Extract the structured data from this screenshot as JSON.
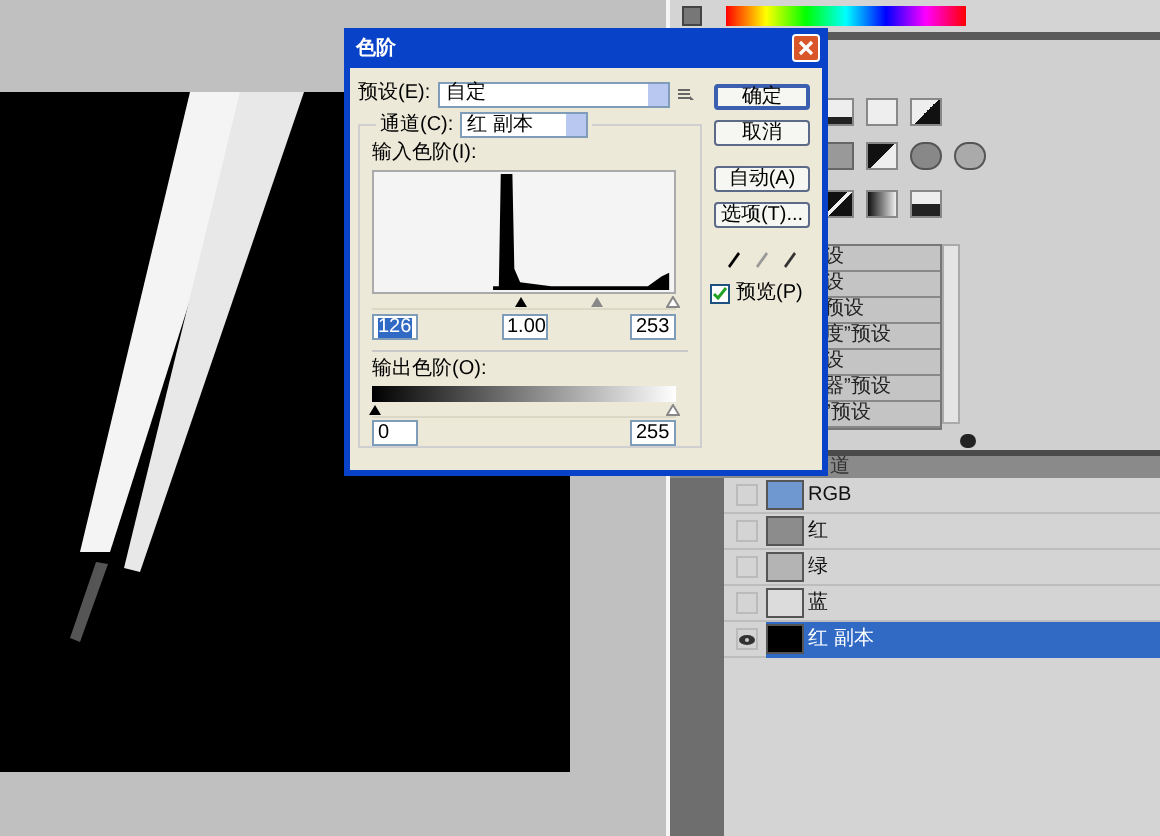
{
  "panels": {
    "presets": [
      "设",
      "设",
      "预设",
      "度”预设",
      "设",
      "器”预设",
      "”预设"
    ],
    "channels_tab": "道",
    "channels": [
      {
        "name": "RGB",
        "visible": false,
        "selected": false,
        "color": "#6f97d0"
      },
      {
        "name": "红",
        "visible": false,
        "selected": false,
        "color": "#8c8c8c"
      },
      {
        "name": "绿",
        "visible": false,
        "selected": false,
        "color": "#b4b4b4"
      },
      {
        "name": "蓝",
        "visible": false,
        "selected": false,
        "color": "#dcdcdc"
      },
      {
        "name": "红 副本",
        "visible": true,
        "selected": true,
        "color": "#000000"
      }
    ]
  },
  "dialog": {
    "title": "色阶",
    "preset_label": "预设(E):",
    "preset_value": "自定",
    "channel_label": "通道(C):",
    "channel_value": "红 副本",
    "input_label": "输入色阶(I):",
    "input_values": [
      {
        "value": "126",
        "selected": true
      },
      {
        "value": "1.00",
        "selected": false
      },
      {
        "value": "253",
        "selected": false
      }
    ],
    "input_thumbs": [
      {
        "kind": "black",
        "level": 0.49
      },
      {
        "kind": "gray",
        "level": 0.74
      },
      {
        "kind": "white",
        "level": 0.99
      }
    ],
    "output_label": "输出色阶(O):",
    "output_values": [
      "0",
      "255"
    ],
    "output_thumbs": [
      {
        "kind": "black",
        "level": 0.01
      },
      {
        "kind": "white",
        "level": 0.99
      }
    ],
    "buttons": [
      {
        "label": "确定",
        "default": true
      },
      {
        "label": "取消",
        "default": false
      },
      {
        "label": "自动(A)",
        "default": false
      },
      {
        "label": "选项(T)...",
        "default": false
      }
    ],
    "preview": {
      "label": "预览(P)",
      "checked": true
    }
  }
}
